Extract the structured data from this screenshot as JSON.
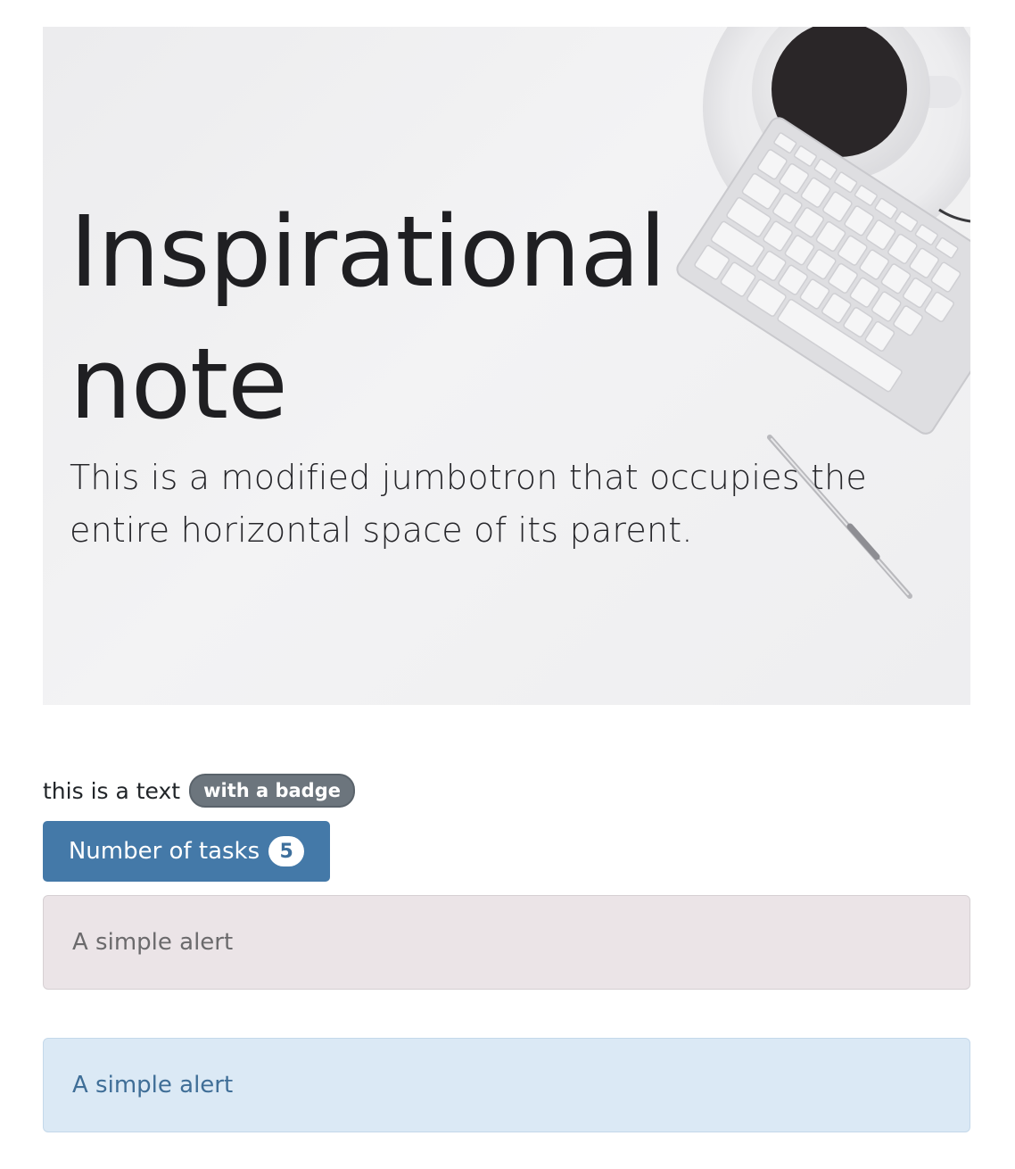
{
  "jumbotron": {
    "title": "Inspirational note",
    "lead": "This is a modified jumbotron that occupies the entire horizontal space of its parent."
  },
  "badge_text": {
    "text": "this is a text",
    "badge": "with a badge"
  },
  "tasks_button": {
    "label": "Number of tasks",
    "count": "5"
  },
  "alerts": [
    {
      "text": "A simple alert",
      "variant": "muted",
      "color": "#ebe4e7"
    },
    {
      "text": "A simple alert",
      "variant": "info",
      "color": "#dbe9f5"
    }
  ],
  "colors": {
    "button": "#4479a8",
    "badge": "#6c757d"
  }
}
